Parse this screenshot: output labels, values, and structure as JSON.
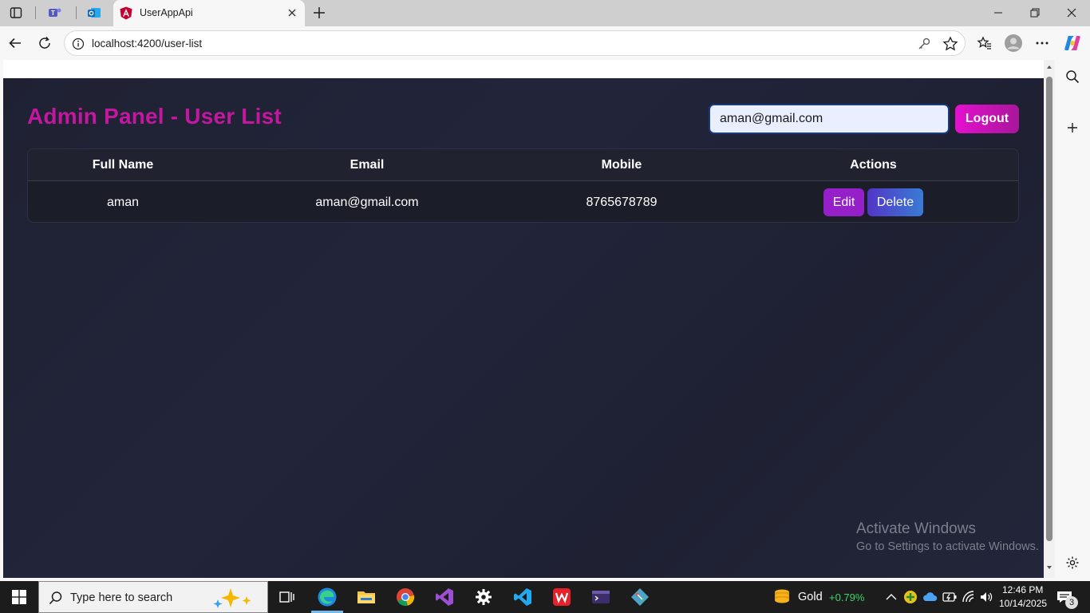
{
  "browser": {
    "tab_title": "UserAppApi",
    "url": "localhost:4200/user-list"
  },
  "app": {
    "title": "Admin Panel - User List",
    "search_email_value": "aman@gmail.com",
    "logout_label": "Logout",
    "table": {
      "headers": [
        "Full Name",
        "Email",
        "Mobile",
        "Actions"
      ],
      "rows": [
        {
          "full_name": "aman",
          "email": "aman@gmail.com",
          "mobile": "8765678789"
        }
      ],
      "edit_label": "Edit",
      "delete_label": "Delete"
    }
  },
  "watermark": {
    "line1": "Activate Windows",
    "line2": "Go to Settings to activate Windows."
  },
  "taskbar": {
    "search_placeholder": "Type here to search",
    "stock_name": "Gold",
    "stock_change": "+0.79%",
    "time": "12:46 PM",
    "date": "10/14/2025",
    "notification_count": "3"
  },
  "colors": {
    "brand_title": "#c3179f",
    "logout": "#e40fcf",
    "edit": "#9520c9",
    "delete": "#3a7bd4",
    "stock_up": "#3fd66c"
  }
}
